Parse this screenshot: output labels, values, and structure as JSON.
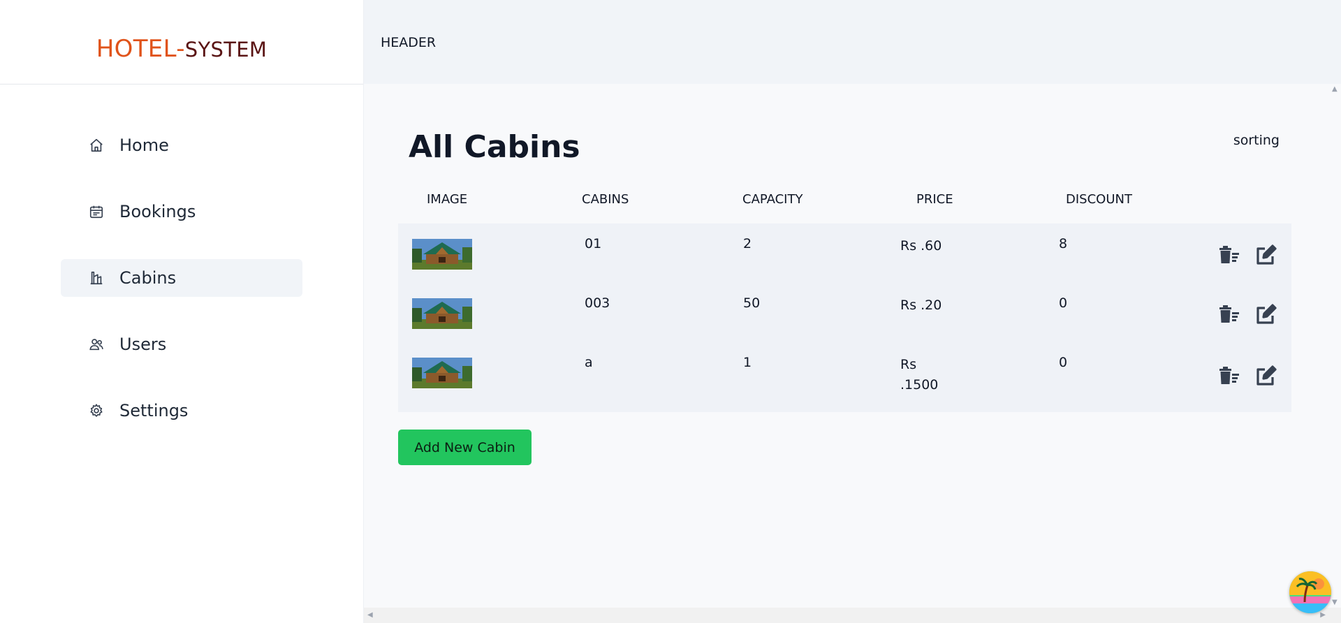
{
  "brand": {
    "part1": "HOTEL-",
    "part2": "SYSTEM"
  },
  "nav": [
    {
      "label": "Home",
      "icon": "home-icon",
      "active": false
    },
    {
      "label": "Bookings",
      "icon": "calendar-icon",
      "active": false
    },
    {
      "label": "Cabins",
      "icon": "building-icon",
      "active": true
    },
    {
      "label": "Users",
      "icon": "users-icon",
      "active": false
    },
    {
      "label": "Settings",
      "icon": "gear-icon",
      "active": false
    }
  ],
  "header": {
    "label": "HEADER"
  },
  "main": {
    "title": "All Cabins",
    "sorting": "sorting",
    "columns": [
      "IMAGE",
      "CABINS",
      "CAPACITY",
      "PRICE",
      "DISCOUNT"
    ],
    "rows": [
      {
        "cabin": "01",
        "capacity": "2",
        "price": "Rs .60",
        "discount": "8"
      },
      {
        "cabin": "003",
        "capacity": "50",
        "price": "Rs .20",
        "discount": "0"
      },
      {
        "cabin": "a",
        "capacity": "1",
        "price": "Rs .1500",
        "discount": "0"
      }
    ],
    "add_button": "Add New Cabin"
  },
  "colors": {
    "accent": "#22c55e",
    "brand_primary": "#e0531a",
    "brand_secondary": "#5a1414",
    "row_bg": "#eff2f7"
  }
}
